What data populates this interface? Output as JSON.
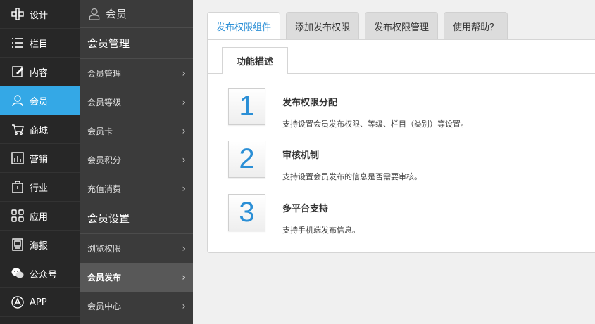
{
  "nav_primary": [
    {
      "label": "设计",
      "icon": "design-icon"
    },
    {
      "label": "栏目",
      "icon": "list-icon"
    },
    {
      "label": "内容",
      "icon": "edit-icon"
    },
    {
      "label": "会员",
      "icon": "user-icon",
      "active": true
    },
    {
      "label": "商城",
      "icon": "cart-icon"
    },
    {
      "label": "营销",
      "icon": "chart-icon"
    },
    {
      "label": "行业",
      "icon": "industry-icon"
    },
    {
      "label": "应用",
      "icon": "apps-icon"
    },
    {
      "label": "海报",
      "icon": "poster-icon"
    },
    {
      "label": "公众号",
      "icon": "wechat-icon"
    },
    {
      "label": "APP",
      "icon": "appstore-icon"
    }
  ],
  "nav_secondary": {
    "header": "会员",
    "section1": "会员管理",
    "items1": [
      "会员管理",
      "会员等级",
      "会员卡",
      "会员积分",
      "充值消费"
    ],
    "section2": "会员设置",
    "items2": [
      "浏览权限",
      "会员发布",
      "会员中心"
    ],
    "active_item": "会员发布"
  },
  "tabs": [
    "发布权限组件",
    "添加发布权限",
    "发布权限管理",
    "使用帮助？"
  ],
  "subtab": "功能描述",
  "features": [
    {
      "num": "1",
      "title": "发布权限分配",
      "desc": "支持设置会员发布权限、等级、栏目（类别）等设置。"
    },
    {
      "num": "2",
      "title": "审核机制",
      "desc": "支持设置会员发布的信息是否需要审核。"
    },
    {
      "num": "3",
      "title": "多平台支持",
      "desc": "支持手机端发布信息。"
    }
  ],
  "colors": {
    "accent": "#34a8e6",
    "link": "#2b8fd6"
  }
}
